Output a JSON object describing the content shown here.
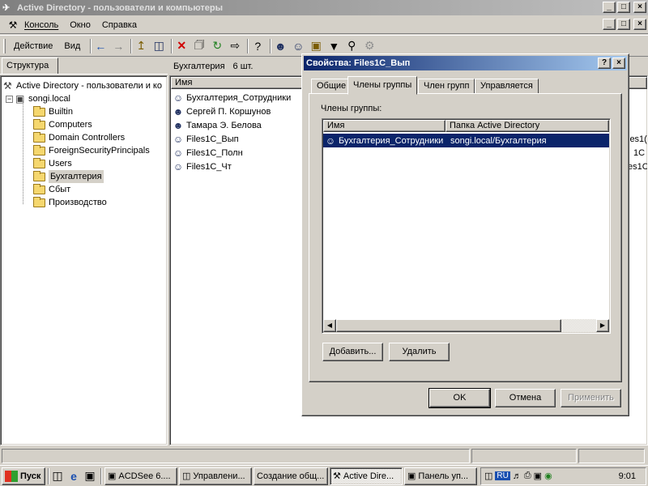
{
  "main_window": {
    "title": "Active Directory - пользователи и компьютеры"
  },
  "menubar": {
    "items": [
      "Консоль",
      "Окно",
      "Справка"
    ]
  },
  "toolbar": {
    "action_label": "Действие",
    "view_label": "Вид"
  },
  "tree": {
    "tab_label": "Структура",
    "root_label": "Active Directory - пользователи и ко",
    "domain_label": "songi.local",
    "items": [
      "Builtin",
      "Computers",
      "Domain Controllers",
      "ForeignSecurityPrincipals",
      "Users",
      "Бухгалтерия",
      "Сбыт",
      "Производство"
    ]
  },
  "list": {
    "header": "Бухгалтерия",
    "count": "6 шт.",
    "column_name": "Имя",
    "rows": [
      "Бухгалтерия_Сотрудники",
      "Сергей П. Коршунов",
      "Тамара Э. Белова",
      "Files1C_Вып",
      "Files1C_Полн",
      "Files1C_Чт"
    ],
    "right_edge_texts": [
      "les1(",
      "1C",
      "es1C"
    ]
  },
  "dialog": {
    "title": "Свойства: Files1C_Вып",
    "tabs": [
      "Общие",
      "Члены группы",
      "Член групп",
      "Управляется"
    ],
    "members_label": "Члены группы:",
    "col_name": "Имя",
    "col_folder": "Папка Active Directory",
    "members": [
      {
        "name": "Бухгалтерия_Сотрудники",
        "folder": "songi.local/Бухгалтерия"
      }
    ],
    "add_button": "Добавить...",
    "remove_button": "Удалить",
    "ok_button": "OK",
    "cancel_button": "Отмена",
    "apply_button": "Применить"
  },
  "taskbar": {
    "start_label": "Пуск",
    "tasks": [
      "ACDSee 6....",
      "Управлени...",
      "Создание общ...",
      "Active Dire...",
      "Панель уп..."
    ],
    "lang": "RU",
    "clock": "9:01"
  }
}
